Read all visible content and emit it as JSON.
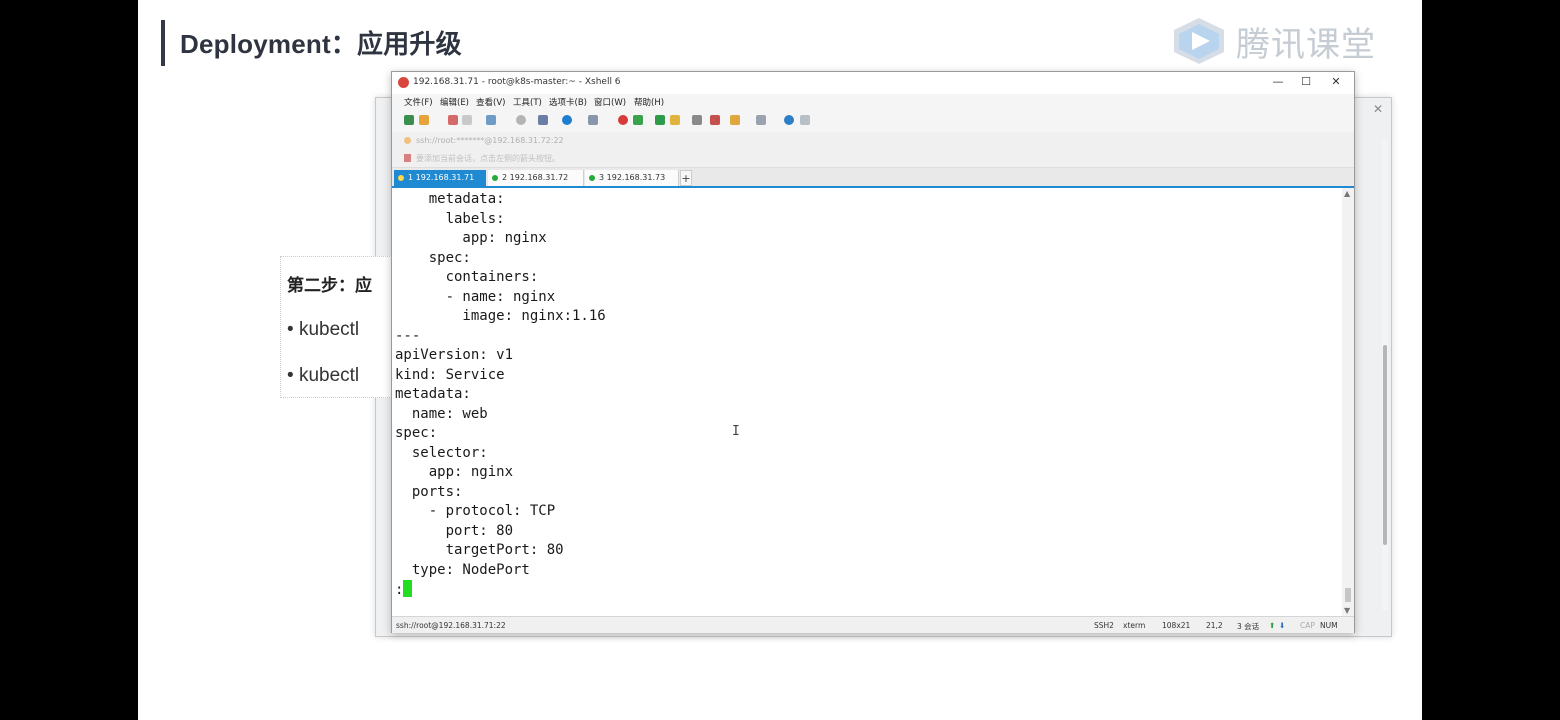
{
  "slide": {
    "title": "Deployment：应用升级",
    "logo_text": "腾讯课堂",
    "step_heading": "第二步：应",
    "bullets": [
      "kubectl",
      "kubectl"
    ]
  },
  "xshell": {
    "window_title": "192.168.31.71 - root@k8s-master:~ - Xshell 6",
    "window_buttons": [
      "—",
      "☐",
      "✕"
    ],
    "menu": [
      "文件(F)",
      "编辑(E)",
      "查看(V)",
      "工具(T)",
      "选项卡(B)",
      "窗口(W)",
      "帮助(H)"
    ],
    "address": "ssh://root:*******@192.168.31.72:22",
    "link_bar": "要添加当前会话，点击左侧的箭头按钮。",
    "tabs": [
      {
        "label": "1 192.168.31.71",
        "active": true
      },
      {
        "label": "2 192.168.31.72",
        "active": false
      },
      {
        "label": "3 192.168.31.73",
        "active": false
      }
    ],
    "tab_add": "+",
    "terminal_lines": [
      "    metadata:",
      "      labels:",
      "        app: nginx",
      "    spec:",
      "      containers:",
      "      - name: nginx",
      "        image: nginx:1.16",
      "---",
      "apiVersion: v1",
      "kind: Service",
      "metadata:",
      "  name: web",
      "spec:",
      "  selector:",
      "    app: nginx",
      "  ports:",
      "    - protocol: TCP",
      "      port: 80",
      "      targetPort: 80",
      "  type: NodePort",
      ":"
    ],
    "status": {
      "connection": "ssh://root@192.168.31.71:22",
      "protocol": "SSH2",
      "terminal": "xterm",
      "size": "108x21",
      "position": "21,2",
      "sessions": "3 会话",
      "caps": "CAP",
      "num": "NUM"
    }
  },
  "colors": {
    "tab_active": "#1f8ad1",
    "cursor": "#22dd22",
    "slide_title": "#2e3440"
  }
}
